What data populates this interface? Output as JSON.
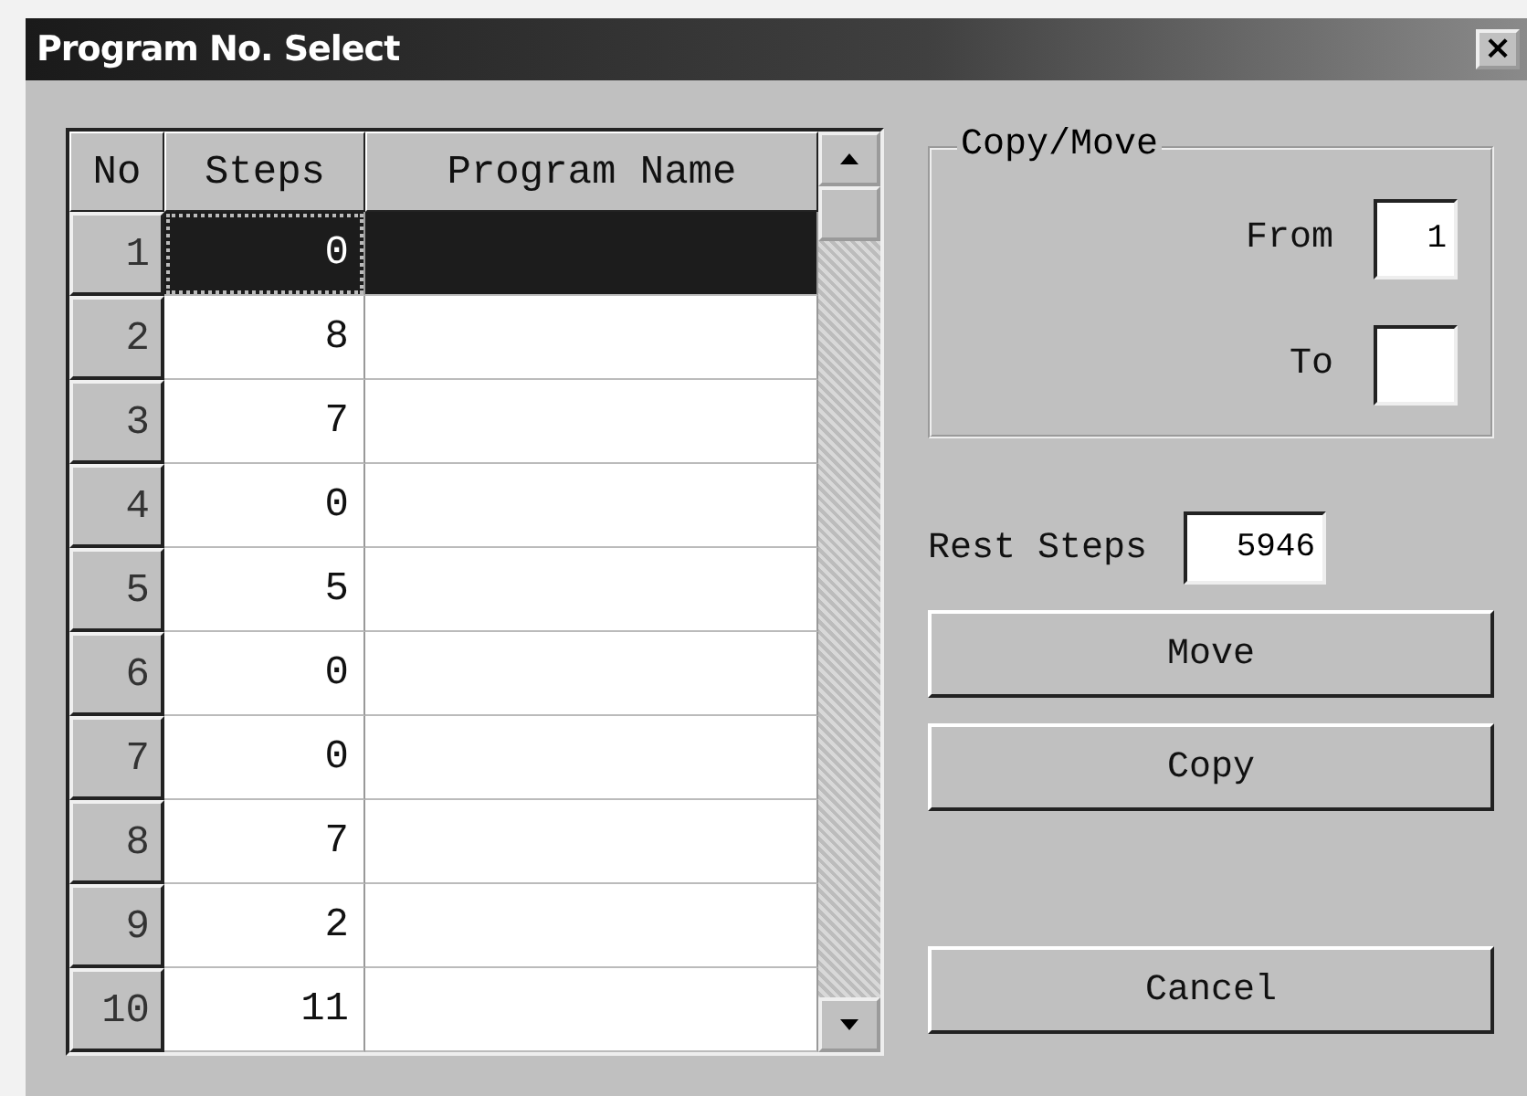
{
  "window": {
    "title": "Program No. Select",
    "close": "×"
  },
  "table": {
    "columns": [
      "No",
      "Steps",
      "Program Name"
    ],
    "rows": [
      {
        "no": "1",
        "steps": "0",
        "selected": true
      },
      {
        "no": "2",
        "steps": "8",
        "selected": false
      },
      {
        "no": "3",
        "steps": "7",
        "selected": false
      },
      {
        "no": "4",
        "steps": "0",
        "selected": false
      },
      {
        "no": "5",
        "steps": "5",
        "selected": false
      },
      {
        "no": "6",
        "steps": "0",
        "selected": false
      },
      {
        "no": "7",
        "steps": "0",
        "selected": false
      },
      {
        "no": "8",
        "steps": "7",
        "selected": false
      },
      {
        "no": "9",
        "steps": "2",
        "selected": false
      },
      {
        "no": "10",
        "steps": "11",
        "selected": false
      }
    ]
  },
  "copy_move": {
    "title": "Copy/Move",
    "from": {
      "label": "From",
      "value": "1"
    },
    "to": {
      "label": "To"
    }
  },
  "rest_steps": {
    "label": "Rest Steps",
    "value": "5946"
  },
  "buttons": [
    "Move",
    "Copy",
    "Cancel"
  ]
}
